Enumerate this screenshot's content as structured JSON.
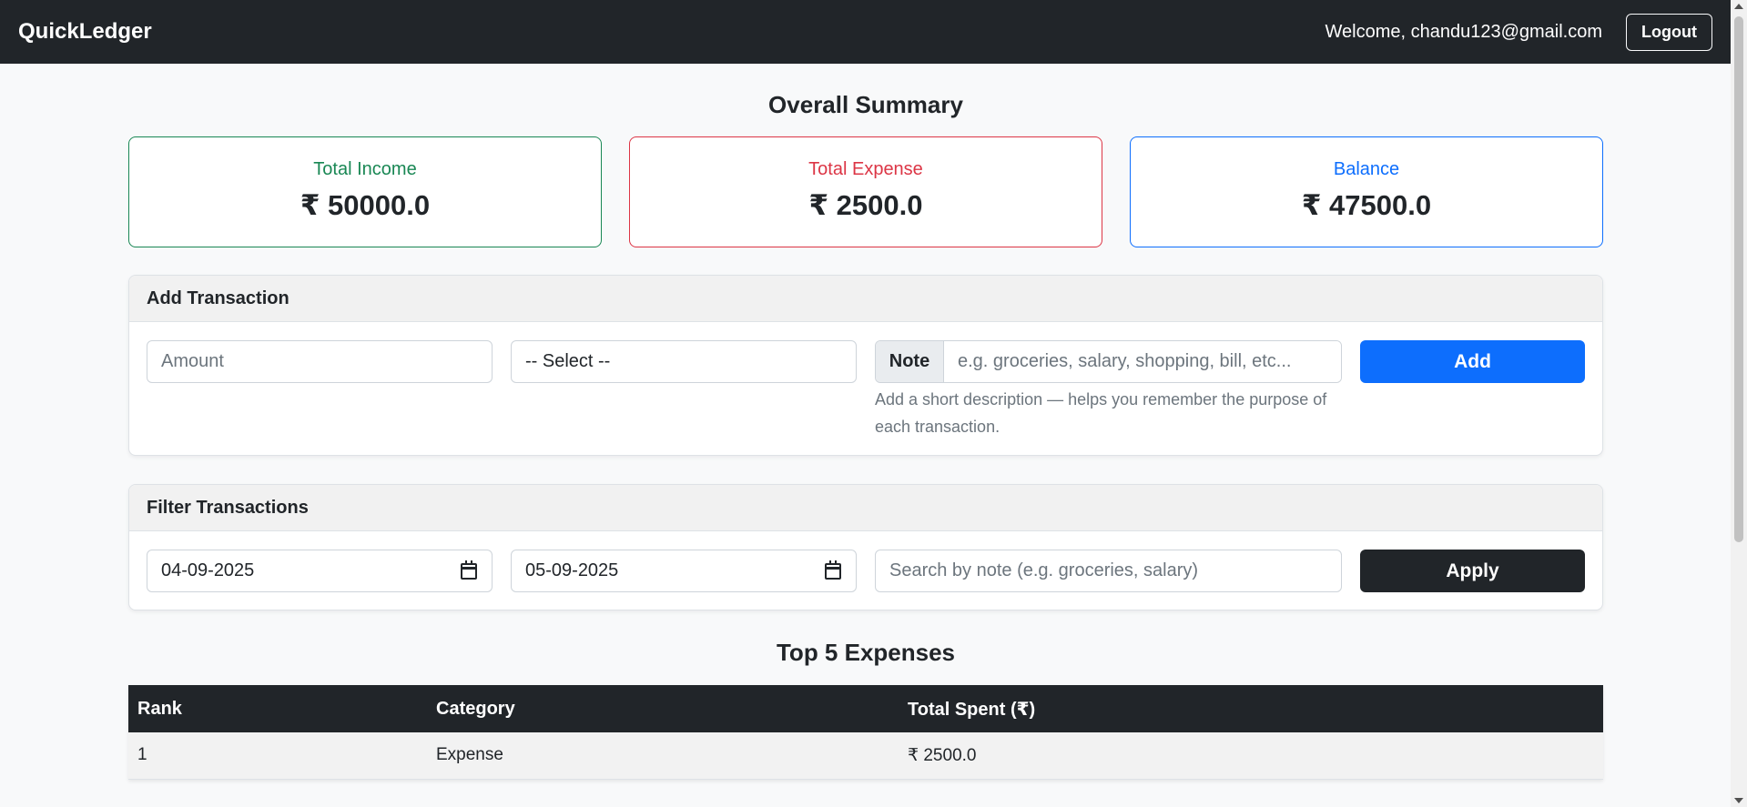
{
  "navbar": {
    "brand": "QuickLedger",
    "welcome": "Welcome, chandu123@gmail.com",
    "logout_label": "Logout"
  },
  "summary": {
    "title": "Overall Summary",
    "income_label": "Total Income",
    "income_value": "₹ 50000.0",
    "expense_label": "Total Expense",
    "expense_value": "₹ 2500.0",
    "balance_label": "Balance",
    "balance_value": "₹ 47500.0"
  },
  "add_transaction": {
    "header": "Add Transaction",
    "amount_placeholder": "Amount",
    "type_selected": "-- Select --",
    "note_addon": "Note",
    "note_placeholder": "e.g. groceries, salary, shopping, bill, etc...",
    "help_line1": "Add a short description — helps you remember the purpose of",
    "help_line2": "each transaction.",
    "add_label": "Add"
  },
  "filter": {
    "header": "Filter Transactions",
    "from_date": "04-09-2025",
    "to_date": "05-09-2025",
    "search_placeholder": "Search by note (e.g. groceries, salary)",
    "apply_label": "Apply"
  },
  "top_expenses": {
    "title": "Top 5 Expenses",
    "columns": [
      "Rank",
      "Category",
      "Total Spent (₹)"
    ],
    "rows": [
      [
        "1",
        "Expense",
        "₹ 2500.0"
      ]
    ]
  },
  "colors": {
    "navbar": "#212529",
    "income": "#198754",
    "expense": "#dc3545",
    "balance": "#0d6efd",
    "primary_button": "#0d6efd",
    "dark_button": "#212529"
  },
  "icons": {
    "date_picker": "calendar-icon"
  }
}
